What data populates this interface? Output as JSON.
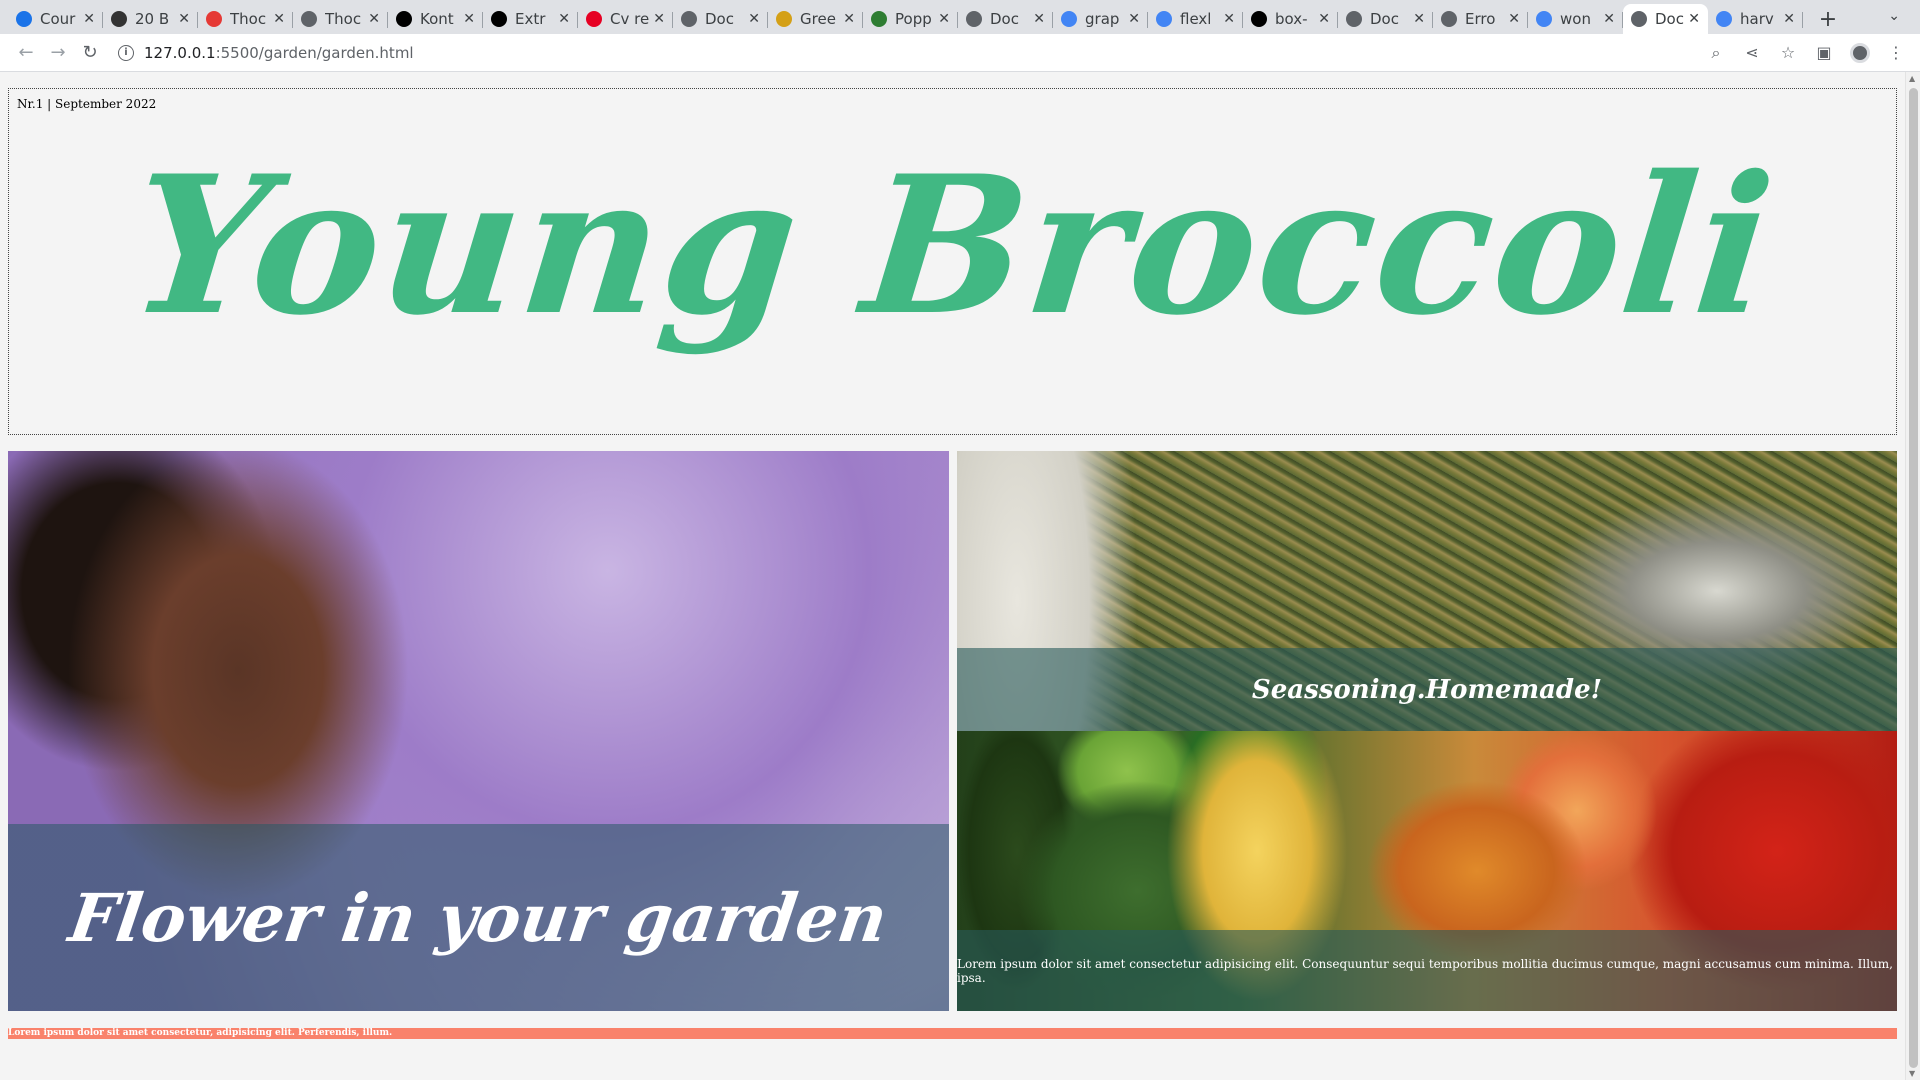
{
  "browser": {
    "tabs": [
      {
        "title": "Cour",
        "icon": "grid-icon",
        "color": "#1a73e8"
      },
      {
        "title": "20 B",
        "icon": "image-icon",
        "color": "#333333"
      },
      {
        "title": "Thoc",
        "icon": "plus-circle-icon",
        "color": "#e53935"
      },
      {
        "title": "Thoc",
        "icon": "globe-icon",
        "color": "#5f6368"
      },
      {
        "title": "Kont",
        "icon": "mb-icon",
        "color": "#000000"
      },
      {
        "title": "Extr",
        "icon": "book-icon",
        "color": "#000000"
      },
      {
        "title": "Cv re",
        "icon": "pinterest-icon",
        "color": "#e60023"
      },
      {
        "title": "Doc",
        "icon": "globe-icon",
        "color": "#5f6368"
      },
      {
        "title": "Gree",
        "icon": "person-icon",
        "color": "#d4a017"
      },
      {
        "title": "Popp",
        "icon": "flag-icon",
        "color": "#2e7d32"
      },
      {
        "title": "Doc",
        "icon": "globe-icon",
        "color": "#5f6368"
      },
      {
        "title": "grap",
        "icon": "google-icon",
        "color": "#4285f4"
      },
      {
        "title": "flexl",
        "icon": "google-icon",
        "color": "#4285f4"
      },
      {
        "title": "box-",
        "icon": "medium-icon",
        "color": "#000000"
      },
      {
        "title": "Doc",
        "icon": "globe-icon",
        "color": "#5f6368"
      },
      {
        "title": "Erro",
        "icon": "globe-icon",
        "color": "#5f6368"
      },
      {
        "title": "won",
        "icon": "google-icon",
        "color": "#4285f4"
      },
      {
        "title": "Doc",
        "icon": "globe-icon",
        "color": "#5f6368",
        "active": true
      },
      {
        "title": "harv",
        "icon": "google-icon",
        "color": "#4285f4"
      }
    ],
    "url_host": "127.0.0.1",
    "url_path": ":5500/garden/garden.html"
  },
  "page": {
    "issue": "Nr.1 | September 2022",
    "brand": "Young Broccoli",
    "card_left_title": "Flower in your garden",
    "card_right_title": "Seassoning.Homemade!",
    "card_right_text": "Lorem ipsum dolor sit amet consectetur adipisicing elit. Consequuntur sequi temporibus mollitia ducimus cumque, magni accusamus cum minima. Illum, ipsa.",
    "footer_text": "Lorem ipsum dolor sit amet consectetur, adipisicing elit. Perferendis, illum."
  },
  "colors": {
    "brand": "#41b883",
    "footer": "#f9826b",
    "page_bg": "#f4f4f4"
  }
}
